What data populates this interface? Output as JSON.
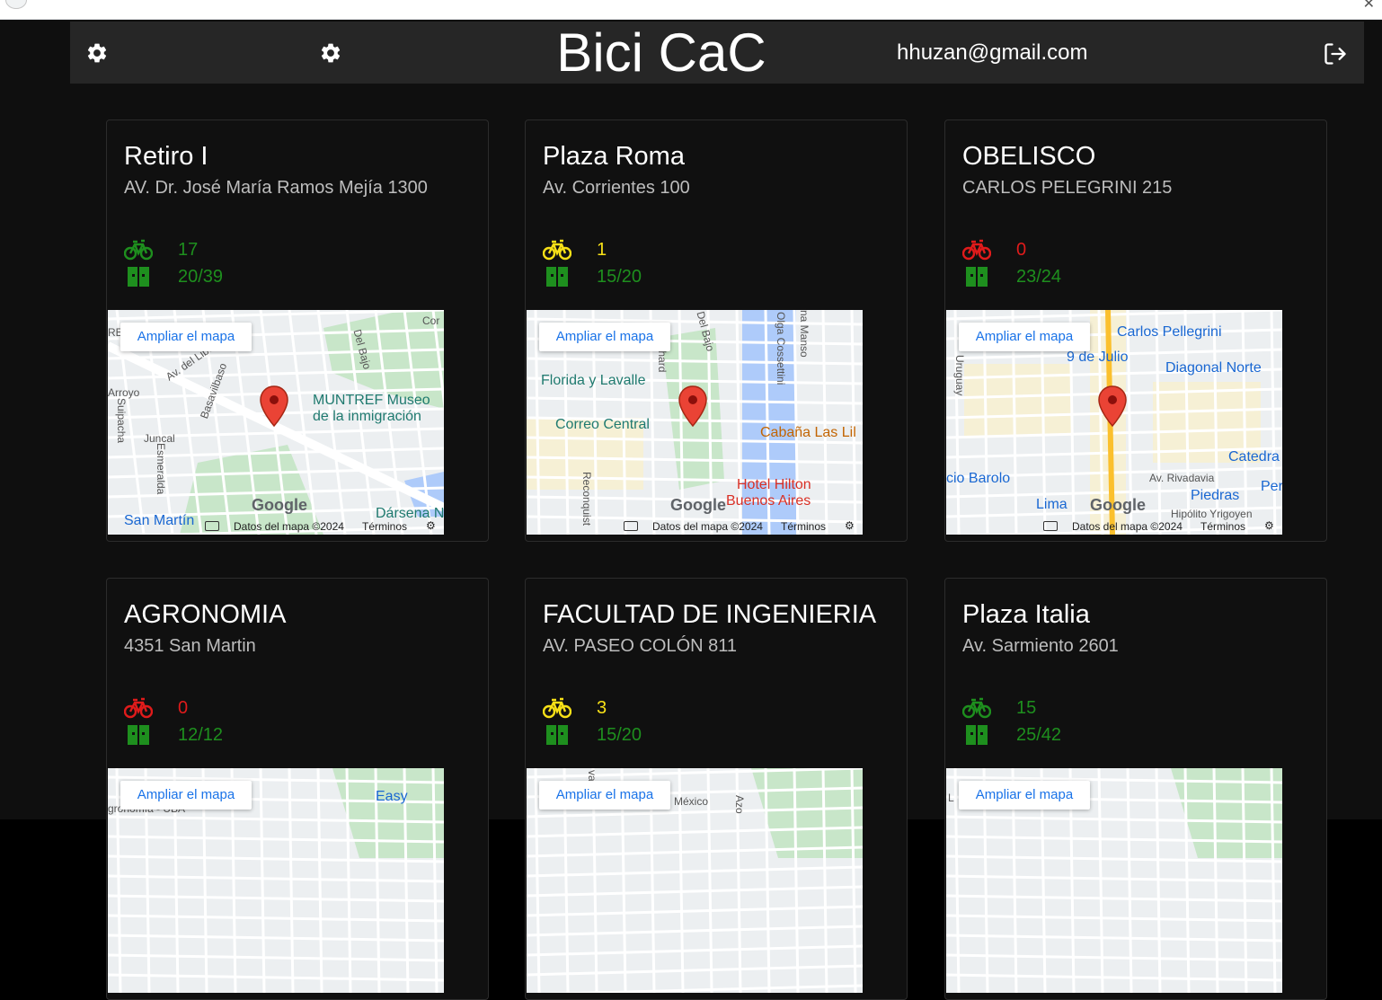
{
  "app": {
    "title": "Bici CaC",
    "user_email": "hhuzan@gmail.com"
  },
  "map_common": {
    "enlarge_label": "Ampliar el mapa",
    "data_label": "Datos del mapa ©2024",
    "terms_label": "Términos",
    "google_label": "Google"
  },
  "stations": [
    {
      "name": "Retiro I",
      "address": "AV. Dr. José María Ramos Mejía 1300",
      "bikes": "17",
      "docks": "20/39",
      "bikes_status": "green",
      "map_labels": [
        "MUNTREF Museo",
        "de la inmigración",
        "Av. del Libertador",
        "Del Bajo",
        "Arroyo",
        "Suipacha",
        "Juncal",
        "Esmeralda",
        "Basavilbaso",
        "San Martín",
        "Dársena N",
        "Cor",
        "RE"
      ]
    },
    {
      "name": "Plaza Roma",
      "address": "Av. Corrientes 100",
      "bikes": "1",
      "docks": "15/20",
      "bikes_status": "yellow",
      "map_labels": [
        "Florida y Lavalle",
        "Correo Central",
        "Cabaña Las Lil",
        "Hotel Hilton",
        "Buenos Aires",
        "Bouchard",
        "Del Bajo",
        "Olga Cossettini",
        "Reconquist",
        "na Manso"
      ]
    },
    {
      "name": "OBELISCO",
      "address": "CARLOS PELEGRINI 215",
      "bikes": "0",
      "docks": "23/24",
      "bikes_status": "red",
      "map_labels": [
        "Carlos Pellegrini",
        "9 de Julio",
        "Diagonal Norte",
        "Uruguay",
        "Catedra",
        "Av. Rivadavia",
        "cio Barolo",
        "Piedras",
        "Lima",
        "Peru",
        "Hipólito Yrigoyen"
      ]
    },
    {
      "name": "AGRONOMIA",
      "address": "4351 San Martin",
      "bikes": "0",
      "docks": "12/12",
      "bikes_status": "red",
      "map_labels": [
        "Easy",
        "gronomía - UBA"
      ]
    },
    {
      "name": "FACULTAD DE INGENIERIA",
      "address": "AV. PASEO COLÓN 811",
      "bikes": "3",
      "docks": "15/20",
      "bikes_status": "yellow",
      "map_labels": [
        "México",
        "Azo",
        "va"
      ]
    },
    {
      "name": "Plaza Italia",
      "address": "Av. Sarmiento 2601",
      "bikes": "15",
      "docks": "25/42",
      "bikes_status": "green",
      "map_labels": [
        "L"
      ]
    }
  ]
}
